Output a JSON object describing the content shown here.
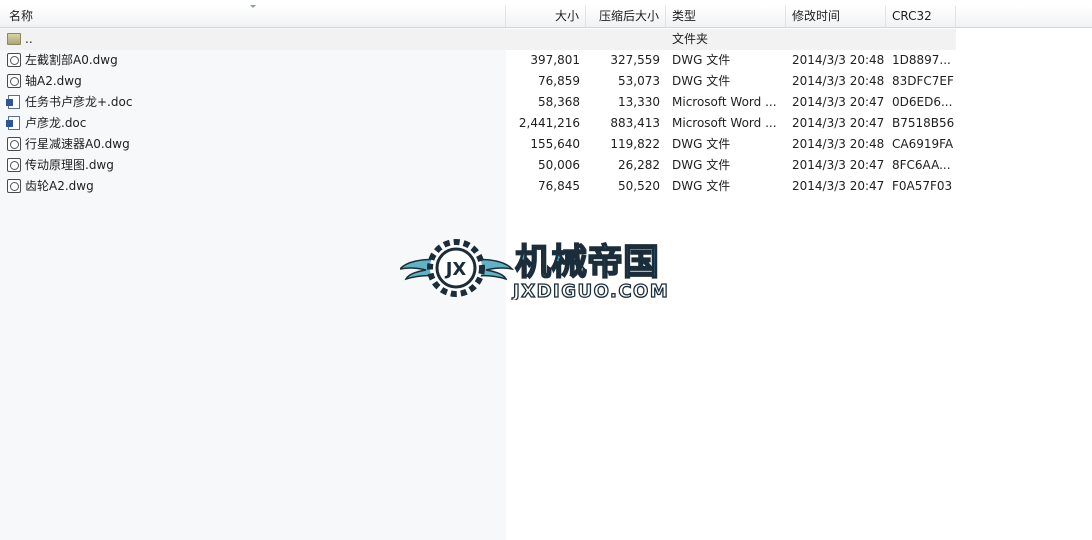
{
  "columns": {
    "name": "名称",
    "size": "大小",
    "packed": "压缩后大小",
    "type": "类型",
    "modified": "修改时间",
    "crc": "CRC32"
  },
  "parent_row": {
    "name": "..",
    "type": "文件夹"
  },
  "rows": [
    {
      "icon": "dwg-file-icon",
      "name": "左截割部A0.dwg",
      "size": "397,801",
      "packed": "327,559",
      "type": "DWG 文件",
      "modified": "2014/3/3 20:48",
      "crc": "1D8897..."
    },
    {
      "icon": "dwg-file-icon",
      "name": "轴A2.dwg",
      "size": "76,859",
      "packed": "53,073",
      "type": "DWG 文件",
      "modified": "2014/3/3 20:48",
      "crc": "83DFC7EF"
    },
    {
      "icon": "word-doc-icon",
      "name": "任务书卢彦龙+.doc",
      "size": "58,368",
      "packed": "13,330",
      "type": "Microsoft Word ...",
      "modified": "2014/3/3 20:47",
      "crc": "0D6ED6..."
    },
    {
      "icon": "word-doc-icon",
      "name": "卢彦龙.doc",
      "size": "2,441,216",
      "packed": "883,413",
      "type": "Microsoft Word ...",
      "modified": "2014/3/3 20:47",
      "crc": "B7518B56"
    },
    {
      "icon": "dwg-file-icon",
      "name": "行星减速器A0.dwg",
      "size": "155,640",
      "packed": "119,822",
      "type": "DWG 文件",
      "modified": "2014/3/3 20:48",
      "crc": "CA6919FA"
    },
    {
      "icon": "dwg-file-icon",
      "name": "传动原理图.dwg",
      "size": "50,006",
      "packed": "26,282",
      "type": "DWG 文件",
      "modified": "2014/3/3 20:47",
      "crc": "8FC6AA..."
    },
    {
      "icon": "dwg-file-icon",
      "name": "齿轮A2.dwg",
      "size": "76,845",
      "packed": "50,520",
      "type": "DWG 文件",
      "modified": "2014/3/3 20:47",
      "crc": "F0A57F03"
    }
  ],
  "watermark": {
    "title": "机械帝国",
    "domain": "JXDIGUO.COM",
    "emblem": "JX",
    "colors": {
      "wing": "#5fb3c4",
      "text": "#3aa7c0",
      "outline": "#1b2d3a"
    }
  }
}
